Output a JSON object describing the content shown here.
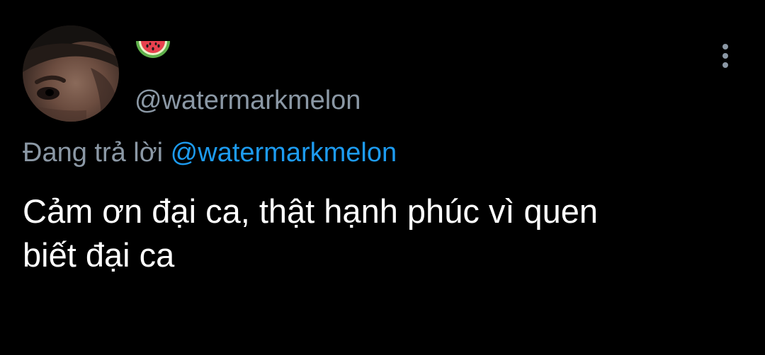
{
  "tweet": {
    "author": {
      "display_name_icon": "watermelon-emoji",
      "handle": "@watermarkmelon"
    },
    "reply_context": {
      "prefix": "Đang trả lời",
      "mention": "@watermarkmelon"
    },
    "text_line_1": "Cảm ơn đại ca, thật hạnh phúc vì quen",
    "text_line_2": "biết đại ca",
    "menu_icon": "more-vertical-icon"
  },
  "colors": {
    "background": "#000000",
    "text_primary": "#ffffff",
    "text_secondary": "#8b98a5",
    "accent": "#1d9bf0"
  }
}
